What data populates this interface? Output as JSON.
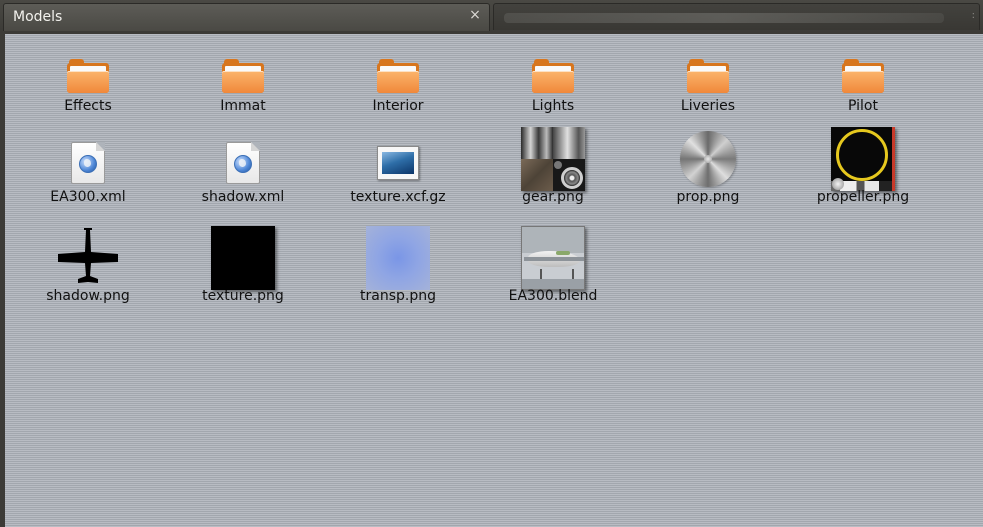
{
  "window": {
    "active_tab_title": "Models",
    "close_glyph": "×"
  },
  "items": [
    {
      "name": "Effects",
      "kind": "folder"
    },
    {
      "name": "Immat",
      "kind": "folder"
    },
    {
      "name": "Interior",
      "kind": "folder"
    },
    {
      "name": "Lights",
      "kind": "folder"
    },
    {
      "name": "Liveries",
      "kind": "folder"
    },
    {
      "name": "Pilot",
      "kind": "folder"
    },
    {
      "name": "EA300.xml",
      "kind": "xml-file"
    },
    {
      "name": "shadow.xml",
      "kind": "xml-file"
    },
    {
      "name": "texture.xcf.gz",
      "kind": "xcf-file"
    },
    {
      "name": "gear.png",
      "kind": "image-file"
    },
    {
      "name": "prop.png",
      "kind": "image-file"
    },
    {
      "name": "propeller.png",
      "kind": "image-file"
    },
    {
      "name": "shadow.png",
      "kind": "image-file"
    },
    {
      "name": "texture.png",
      "kind": "image-file"
    },
    {
      "name": "transp.png",
      "kind": "image-file"
    },
    {
      "name": "EA300.blend",
      "kind": "blend-file"
    }
  ],
  "colors": {
    "folder_orange": "#f0883a",
    "content_background": "#aeb3ba",
    "titlebar_dark": "#3c3b37"
  }
}
